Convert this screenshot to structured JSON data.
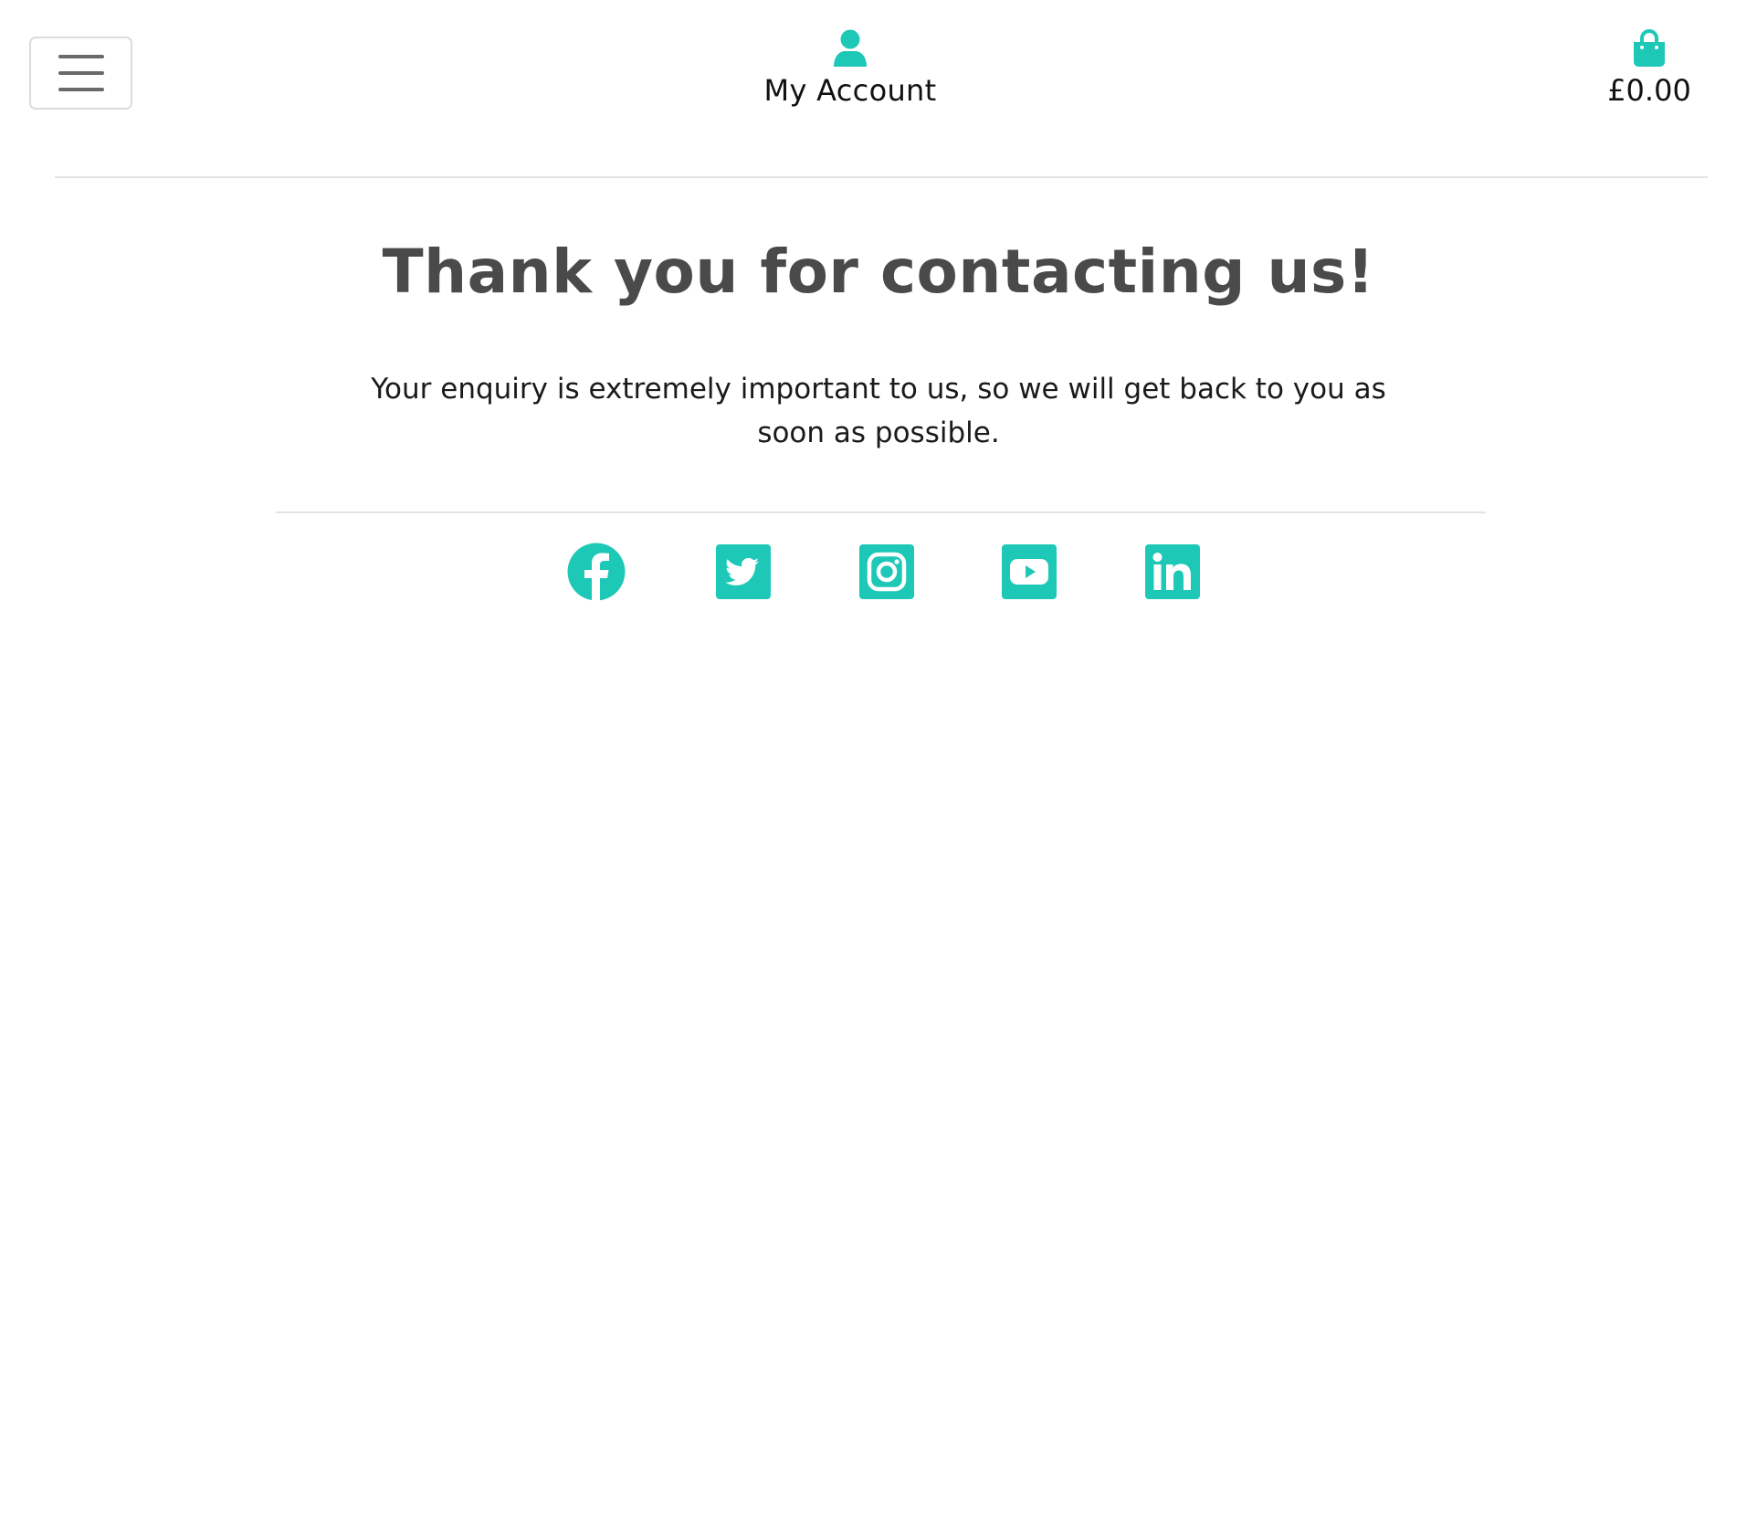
{
  "header": {
    "menu_toggle": {
      "icon": "hamburger-menu-icon"
    },
    "account": {
      "icon": "user-icon",
      "label": "My Account"
    },
    "bag": {
      "icon": "shopping-bag-icon",
      "total": "£0.00"
    }
  },
  "main": {
    "heading": "Thank you for contacting us!",
    "message": "Your enquiry is extremely important to us, so we will get back to you as soon as possible."
  },
  "social": {
    "links": [
      {
        "name": "Facebook",
        "icon": "facebook-icon"
      },
      {
        "name": "Twitter",
        "icon": "twitter-icon"
      },
      {
        "name": "Instagram",
        "icon": "instagram-icon"
      },
      {
        "name": "YouTube",
        "icon": "youtube-icon"
      },
      {
        "name": "LinkedIn",
        "icon": "linkedin-icon"
      }
    ]
  },
  "colors": {
    "accent": "#1ec8b6",
    "heading": "#4a4a4a",
    "text": "#1a1a1a",
    "divider": "#e3e3e3"
  }
}
